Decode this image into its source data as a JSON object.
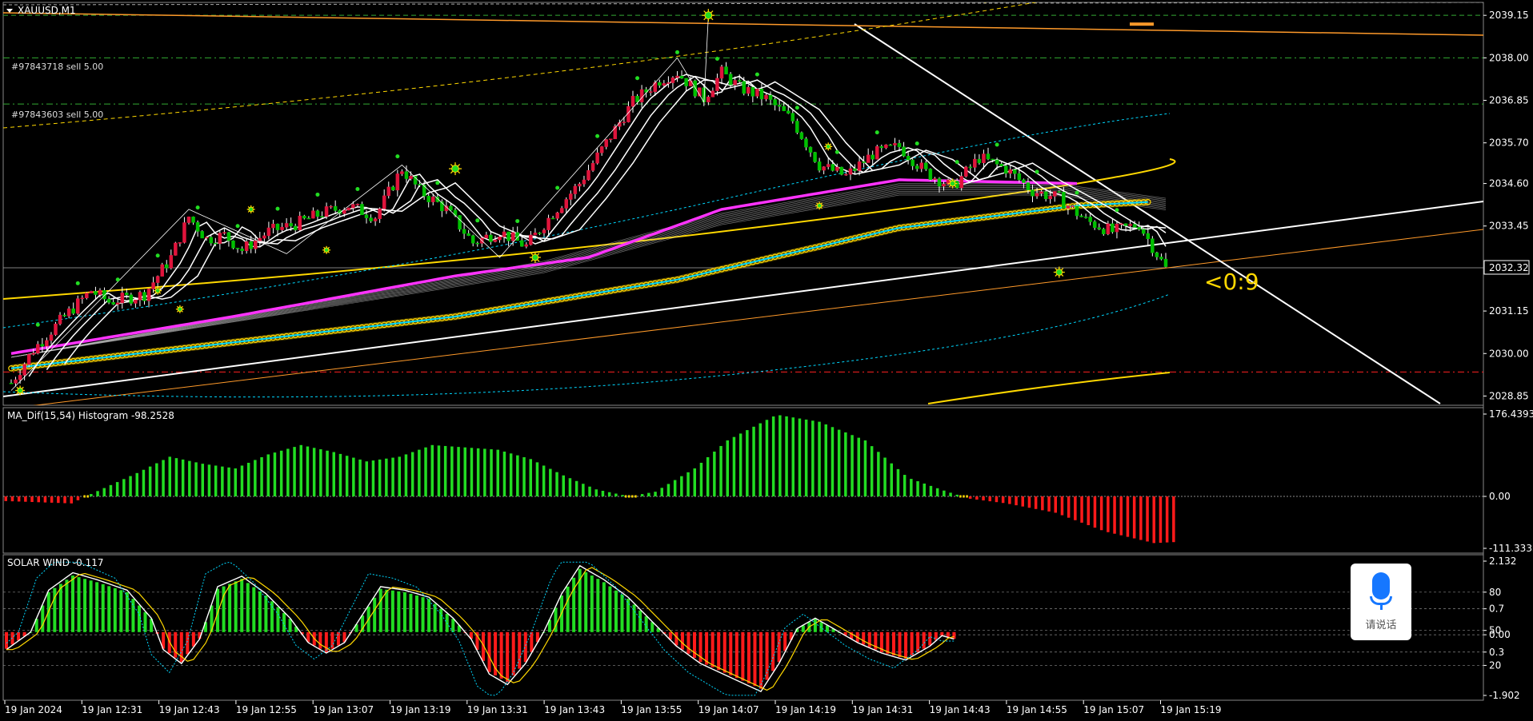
{
  "colors": {
    "background": "#000000",
    "bull": "#00c000",
    "bear": "#e0143c",
    "hist_green": "#22dd22",
    "hist_red": "#ff1a1a",
    "magenta": "#ff33ff",
    "yellow": "#ffd800",
    "cyan": "#00d8ff",
    "orange": "#ff9a2a",
    "white": "#ffffff",
    "green_dash": "#33aa33",
    "red_dash": "#ff2020"
  },
  "icons": {
    "voice": "microphone-icon",
    "menu": "triangle-down-icon"
  },
  "main": {
    "symbol": "XAUUSD,M1",
    "current_price": "2032.32",
    "countdown": "<0:9",
    "orders": [
      "#97843718 sell 5.00",
      "#97843603 sell 5.00"
    ]
  },
  "histogram": {
    "title": "MA_Dif(15,54) Histogram -98.2528"
  },
  "solar": {
    "title": "SOLAR WIND -0.117"
  },
  "voice_button": {
    "label": "请说话"
  },
  "chart_data": [
    {
      "type": "candlestick",
      "series_name": "XAUUSD,M1",
      "y_ticks": [
        "2039.15",
        "2038.00",
        "2036.85",
        "2035.70",
        "2034.60",
        "2033.45",
        "2032.32",
        "2031.15",
        "2030.00",
        "2028.85"
      ],
      "ylim": [
        2028.6,
        2039.5
      ],
      "x_ticks": [
        "19 Jan 2024",
        "19 Jan 12:31",
        "19 Jan 12:43",
        "19 Jan 12:55",
        "19 Jan 13:07",
        "19 Jan 13:19",
        "19 Jan 13:31",
        "19 Jan 13:43",
        "19 Jan 13:55",
        "19 Jan 14:07",
        "19 Jan 14:19",
        "19 Jan 14:31",
        "19 Jan 14:43",
        "19 Jan 14:55",
        "19 Jan 15:07",
        "19 Jan 15:19"
      ],
      "price_path": [
        [
          0,
          2029.2
        ],
        [
          5,
          2030.1
        ],
        [
          12,
          2031.0
        ],
        [
          18,
          2031.7
        ],
        [
          22,
          2031.4
        ],
        [
          30,
          2031.6
        ],
        [
          36,
          2032.6
        ],
        [
          40,
          2033.7
        ],
        [
          44,
          2033.1
        ],
        [
          48,
          2033.2
        ],
        [
          52,
          2032.8
        ],
        [
          58,
          2033.3
        ],
        [
          64,
          2033.5
        ],
        [
          70,
          2033.8
        ],
        [
          76,
          2034.0
        ],
        [
          82,
          2033.7
        ],
        [
          88,
          2035.0
        ],
        [
          92,
          2034.4
        ],
        [
          98,
          2033.9
        ],
        [
          104,
          2033.0
        ],
        [
          110,
          2033.3
        ],
        [
          116,
          2032.9
        ],
        [
          122,
          2033.8
        ],
        [
          128,
          2034.6
        ],
        [
          134,
          2035.7
        ],
        [
          140,
          2036.8
        ],
        [
          146,
          2037.4
        ],
        [
          150,
          2037.6
        ],
        [
          156,
          2036.9
        ],
        [
          160,
          2037.6
        ],
        [
          164,
          2037.2
        ],
        [
          170,
          2036.9
        ],
        [
          176,
          2036.3
        ],
        [
          182,
          2035.1
        ],
        [
          188,
          2034.8
        ],
        [
          194,
          2035.4
        ],
        [
          200,
          2035.6
        ],
        [
          206,
          2034.9
        ],
        [
          212,
          2034.5
        ],
        [
          218,
          2035.3
        ],
        [
          224,
          2035.0
        ],
        [
          230,
          2034.4
        ],
        [
          236,
          2034.2
        ],
        [
          242,
          2033.6
        ],
        [
          248,
          2033.3
        ],
        [
          254,
          2033.5
        ],
        [
          260,
          2032.3
        ]
      ],
      "order_levels": [
        2038.0,
        2036.75
      ],
      "support_level": 2029.5,
      "top_level": 2039.15
    },
    {
      "type": "bar",
      "series_name": "MA_Dif(15,54) Histogram",
      "y_ticks": [
        "176.4393",
        "0.00",
        "-111.3333"
      ],
      "ylim": [
        -111.3333,
        176.4393
      ],
      "profile": [
        [
          0,
          -10
        ],
        [
          20,
          -15
        ],
        [
          26,
          5
        ],
        [
          40,
          50
        ],
        [
          50,
          85
        ],
        [
          60,
          70
        ],
        [
          70,
          60
        ],
        [
          80,
          90
        ],
        [
          90,
          110
        ],
        [
          100,
          95
        ],
        [
          110,
          75
        ],
        [
          120,
          85
        ],
        [
          130,
          110
        ],
        [
          140,
          105
        ],
        [
          150,
          100
        ],
        [
          160,
          80
        ],
        [
          170,
          45
        ],
        [
          180,
          15
        ],
        [
          190,
          0
        ],
        [
          198,
          10
        ],
        [
          210,
          60
        ],
        [
          220,
          120
        ],
        [
          235,
          175
        ],
        [
          248,
          160
        ],
        [
          262,
          120
        ],
        [
          275,
          40
        ],
        [
          287,
          10
        ],
        [
          294,
          -5
        ],
        [
          305,
          -15
        ],
        [
          320,
          -35
        ],
        [
          335,
          -75
        ],
        [
          350,
          -100
        ],
        [
          356,
          -98
        ]
      ]
    },
    {
      "type": "bar",
      "series_name": "SOLAR WIND",
      "y_ticks": [
        "2.132",
        "80",
        "0.7",
        "50",
        "0.00",
        "0.3",
        "20",
        "-1.902"
      ],
      "ylim": [
        -1.902,
        2.132
      ],
      "profile": [
        [
          0,
          -0.5
        ],
        [
          8,
          0.0
        ],
        [
          14,
          1.2
        ],
        [
          22,
          1.7
        ],
        [
          30,
          1.5
        ],
        [
          40,
          1.2
        ],
        [
          48,
          0.4
        ],
        [
          52,
          -0.5
        ],
        [
          58,
          -0.9
        ],
        [
          64,
          -0.2
        ],
        [
          70,
          1.3
        ],
        [
          78,
          1.6
        ],
        [
          86,
          1.1
        ],
        [
          94,
          0.4
        ],
        [
          100,
          -0.3
        ],
        [
          106,
          -0.6
        ],
        [
          112,
          -0.3
        ],
        [
          118,
          0.5
        ],
        [
          124,
          1.3
        ],
        [
          132,
          1.2
        ],
        [
          140,
          1.0
        ],
        [
          148,
          0.4
        ],
        [
          154,
          -0.2
        ],
        [
          160,
          -1.2
        ],
        [
          166,
          -1.5
        ],
        [
          172,
          -0.9
        ],
        [
          178,
          0.0
        ],
        [
          184,
          1.1
        ],
        [
          190,
          1.9
        ],
        [
          198,
          1.5
        ],
        [
          206,
          1.0
        ],
        [
          214,
          0.3
        ],
        [
          222,
          -0.4
        ],
        [
          230,
          -0.9
        ],
        [
          240,
          -1.3
        ],
        [
          250,
          -1.7
        ],
        [
          256,
          -0.9
        ],
        [
          262,
          0.1
        ],
        [
          268,
          0.4
        ],
        [
          274,
          0.1
        ],
        [
          282,
          -0.3
        ],
        [
          290,
          -0.6
        ],
        [
          298,
          -0.8
        ],
        [
          306,
          -0.4
        ],
        [
          310,
          -0.1
        ],
        [
          314,
          -0.2
        ]
      ]
    }
  ]
}
